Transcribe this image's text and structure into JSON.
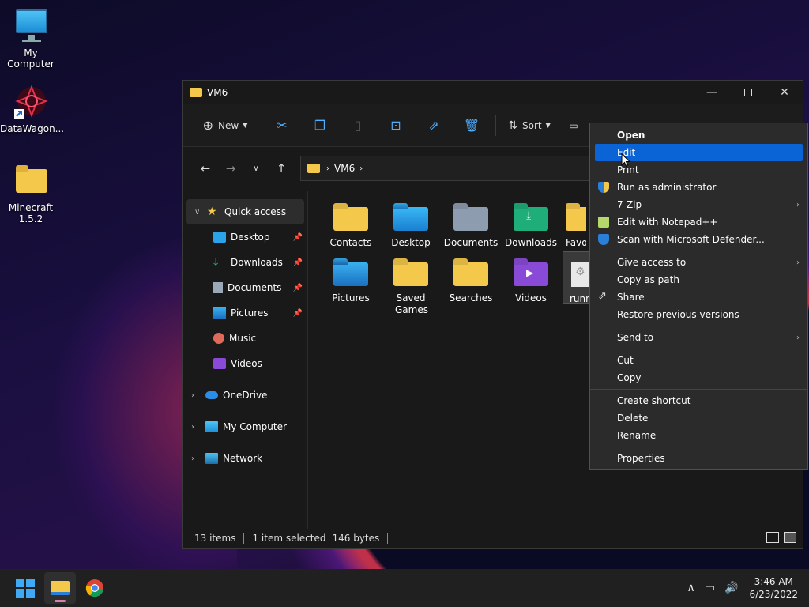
{
  "desktop": {
    "icons": [
      {
        "label": "My Computer"
      },
      {
        "label": "DataWagon..."
      },
      {
        "label": "Minecraft 1.5.2"
      }
    ]
  },
  "window": {
    "title": "VM6",
    "toolbar": {
      "new_label": "New",
      "sort_label": "Sort"
    },
    "address": {
      "crumb": "VM6"
    },
    "sidebar": {
      "items": [
        {
          "label": "Quick access"
        },
        {
          "label": "Desktop"
        },
        {
          "label": "Downloads"
        },
        {
          "label": "Documents"
        },
        {
          "label": "Pictures"
        },
        {
          "label": "Music"
        },
        {
          "label": "Videos"
        },
        {
          "label": "OneDrive"
        },
        {
          "label": "My Computer"
        },
        {
          "label": "Network"
        }
      ]
    },
    "files": [
      {
        "label": "Contacts"
      },
      {
        "label": "Desktop"
      },
      {
        "label": "Documents"
      },
      {
        "label": "Downloads"
      },
      {
        "label": "Favo"
      },
      {
        "label": "Pictures"
      },
      {
        "label": "Saved Games"
      },
      {
        "label": "Searches"
      },
      {
        "label": "Videos"
      },
      {
        "label": "runn"
      }
    ],
    "status": {
      "count": "13 items",
      "selected": "1 item selected",
      "size": "146 bytes"
    }
  },
  "context_menu": {
    "items": [
      {
        "label": "Open"
      },
      {
        "label": "Edit"
      },
      {
        "label": "Print"
      },
      {
        "label": "Run as administrator"
      },
      {
        "label": "7-Zip"
      },
      {
        "label": "Edit with Notepad++"
      },
      {
        "label": "Scan with Microsoft Defender..."
      },
      {
        "label": "Give access to"
      },
      {
        "label": "Copy as path"
      },
      {
        "label": "Share"
      },
      {
        "label": "Restore previous versions"
      },
      {
        "label": "Send to"
      },
      {
        "label": "Cut"
      },
      {
        "label": "Copy"
      },
      {
        "label": "Create shortcut"
      },
      {
        "label": "Delete"
      },
      {
        "label": "Rename"
      },
      {
        "label": "Properties"
      }
    ]
  },
  "taskbar": {
    "time": "3:46 AM",
    "date": "6/23/2022"
  },
  "colors": {
    "accent": "#0a64d6",
    "folder": "#f4c84a"
  }
}
